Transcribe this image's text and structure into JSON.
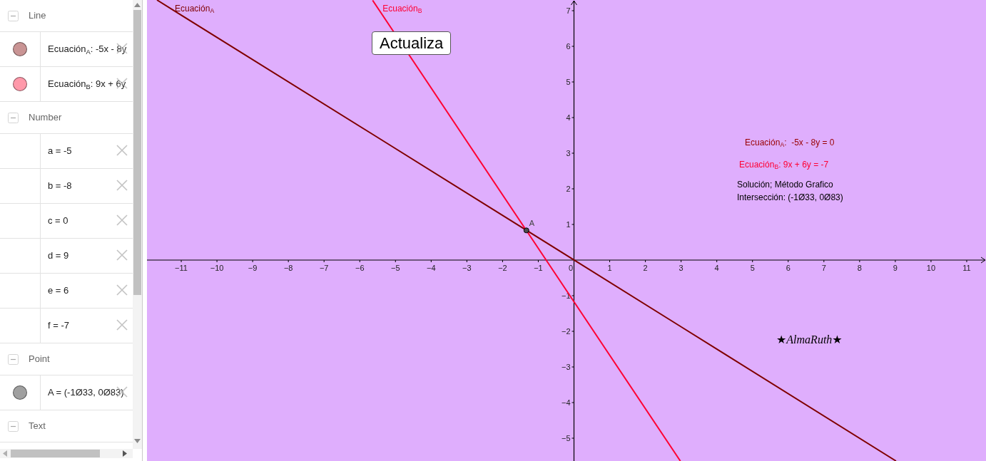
{
  "algebra_view": {
    "groups": [
      {
        "title": "Line",
        "expanded": true,
        "items": [
          {
            "text": "Ecuación$_{A}$: -5x - 8y",
            "color": "#c99494"
          },
          {
            "text": "Ecuación$_{B}$: 9x + 6y",
            "color": "#ff99aa"
          }
        ]
      },
      {
        "title": "Number",
        "expanded": true,
        "items": [
          {
            "text": "a = -5"
          },
          {
            "text": "b = -8"
          },
          {
            "text": "c = 0"
          },
          {
            "text": "d = 9"
          },
          {
            "text": "e = 6"
          },
          {
            "text": "f = -7"
          }
        ]
      },
      {
        "title": "Point",
        "expanded": true,
        "items": [
          {
            "text": "A = (-1Ø33, 0Ø83)",
            "color": "#a0a0a0"
          }
        ]
      },
      {
        "title": "Text",
        "expanded": true
      }
    ]
  },
  "graphics": {
    "button": {
      "label": "Actualiza"
    },
    "texts": [
      {
        "text": "Ecuación$_{A}$:  -5x - 8y = 0",
        "color": "#990000"
      },
      {
        "text": "Ecuación$_{B}$: 9x + 6y = -7",
        "color": "#ff0033"
      },
      {
        "text": "Solución; Método Grafico",
        "color": "#000000"
      },
      {
        "text": "Intersección: (-1Ø33, 0Ø83)",
        "color": "#000000"
      }
    ],
    "signature": "★*AlmaRuth*★",
    "chart_data": {
      "type": "line",
      "x": [
        -11.68,
        -5.64,
        2.98,
        9.02
      ],
      "series": [
        {
          "name": "Ecuación$_{A}$",
          "color": "#800000",
          "values": [
            7.3,
            3.53,
            -1.86,
            -5.64
          ]
        },
        {
          "name": "Ecuación$_{B}$",
          "color": "#ff0033",
          "values": [
            null,
            7.29,
            -5.64,
            null
          ]
        }
      ],
      "xlim": [
        -11.96,
        11.54
      ],
      "ylim": [
        -5.64,
        7.3
      ],
      "xticks": [
        {
          "value": -11,
          "label": "−11"
        },
        {
          "value": -10,
          "label": "−10"
        },
        {
          "value": -9,
          "label": "−9"
        },
        {
          "value": -8,
          "label": "−8"
        },
        {
          "value": -7,
          "label": "−7"
        },
        {
          "value": -6,
          "label": "−6"
        },
        {
          "value": -5,
          "label": "−5"
        },
        {
          "value": -4,
          "label": "−4"
        },
        {
          "value": -3,
          "label": "−3"
        },
        {
          "value": -2,
          "label": "−2"
        },
        {
          "value": -1,
          "label": "−1"
        },
        0,
        1,
        2,
        3,
        4,
        5,
        6,
        7,
        8,
        9,
        10,
        11
      ],
      "yticks": [
        {
          "value": -5,
          "label": "−5"
        },
        {
          "value": -4,
          "label": "−4"
        },
        {
          "value": -3,
          "label": "−3"
        },
        {
          "value": -2,
          "label": "−2"
        },
        {
          "value": -1,
          "label": "−1"
        },
        1,
        2,
        3,
        4,
        5,
        6,
        7
      ],
      "annotations": [
        {
          "text": "A",
          "x": -1.333,
          "y": 0.833
        }
      ]
    }
  }
}
